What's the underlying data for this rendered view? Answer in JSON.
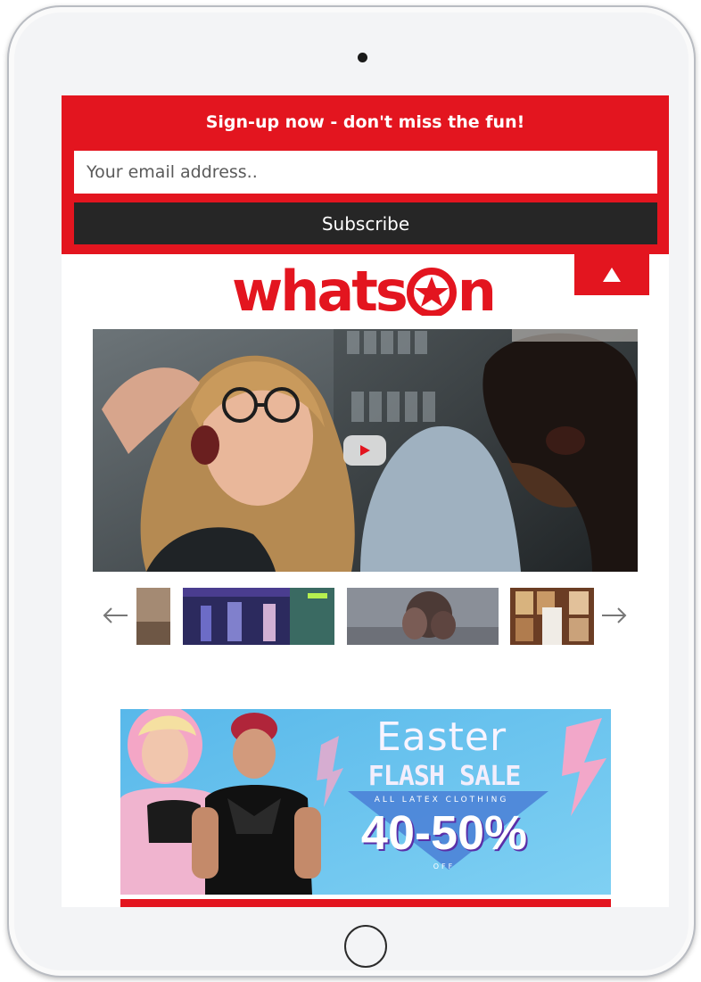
{
  "signup": {
    "title": "Sign-up now - don't miss the fun!",
    "email_placeholder": "Your email address..",
    "subscribe_label": "Subscribe"
  },
  "header": {
    "logo_text_left": "whats",
    "logo_text_right": "n"
  },
  "promo": {
    "line1": "Easter",
    "line2": "FLASH SALE",
    "line3": "ALL LATEX CLOTHING",
    "line4": "40-50%",
    "line5": "OFF"
  },
  "colors": {
    "brand_red": "#e3151f",
    "subscribe_dark": "#262626",
    "ad_blue": "#5cc2ee"
  },
  "icons": {
    "scroll_top": "triangle-up-icon",
    "play": "play-icon",
    "prev": "arrow-left-icon",
    "next": "arrow-right-icon",
    "logo_mark": "star-in-circle-icon"
  }
}
